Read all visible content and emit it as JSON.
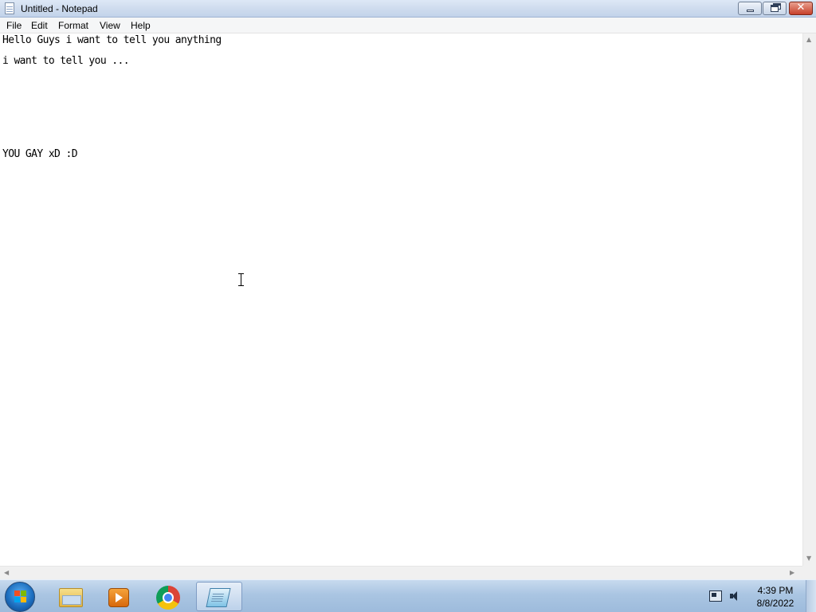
{
  "window": {
    "title": "Untitled - Notepad"
  },
  "menu": {
    "items": [
      "File",
      "Edit",
      "Format",
      "View",
      "Help"
    ]
  },
  "document": {
    "lines": [
      "Hello Guys i want to tell you anything",
      "i want to tell you ...",
      "YOU GAY xD :D"
    ]
  },
  "taskbar": {
    "apps": [
      "windows-explorer-icon",
      "media-player-icon",
      "chrome-icon",
      "notepad-icon"
    ],
    "clock": {
      "time": "4:39 PM",
      "date": "8/8/2022"
    }
  },
  "colors": {
    "titlebar": "#cfdcee",
    "taskbar": "#aac5e2",
    "close_button": "#c7402a"
  }
}
